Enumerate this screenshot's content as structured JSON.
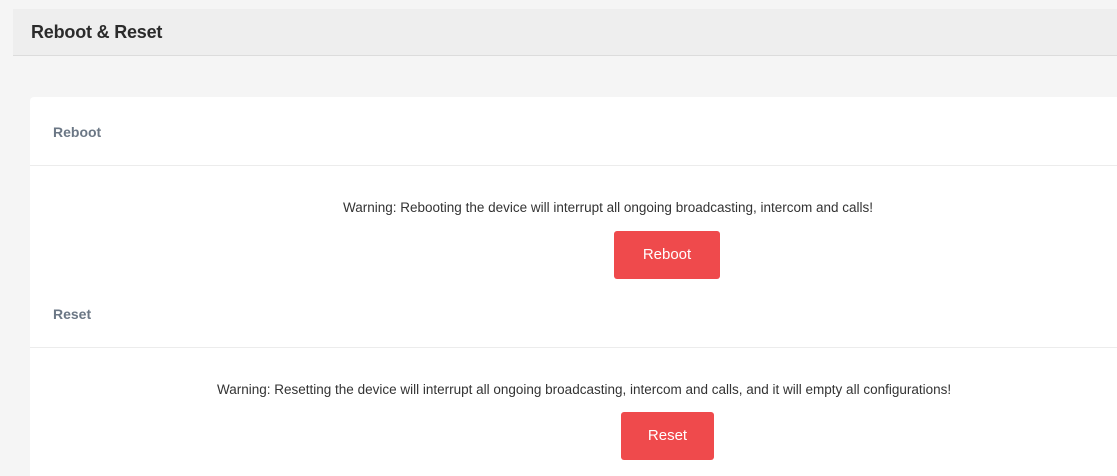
{
  "header": {
    "title": "Reboot & Reset"
  },
  "reboot": {
    "heading": "Reboot",
    "warning": "Warning: Rebooting the device will interrupt all ongoing broadcasting, intercom and calls!",
    "button_label": "Reboot"
  },
  "reset": {
    "heading": "Reset",
    "warning": "Warning: Resetting the device will interrupt all ongoing broadcasting, intercom and calls, and it will empty all configurations!",
    "button_label": "Reset"
  },
  "colors": {
    "danger_button": "#ef4a4c",
    "section_heading": "#6b7785"
  }
}
